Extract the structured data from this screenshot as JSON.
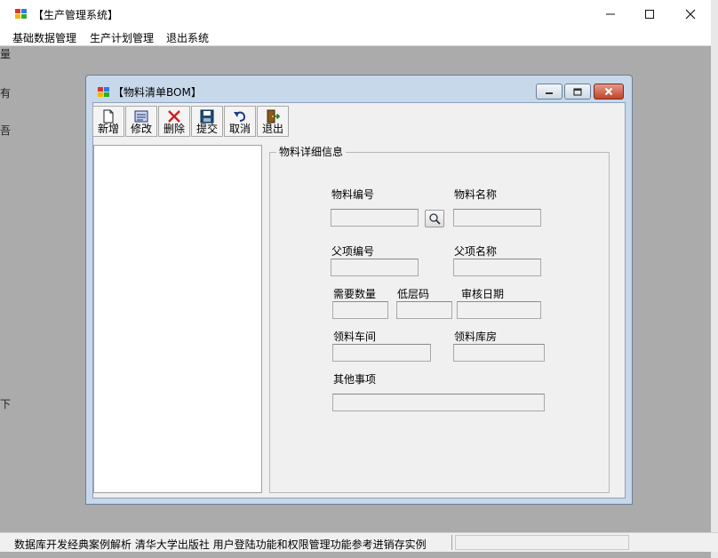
{
  "app": {
    "title": "【生产管理系统】"
  },
  "menu": [
    {
      "label": "基础数据管理"
    },
    {
      "label": "生产计划管理"
    },
    {
      "label": "退出系统"
    }
  ],
  "edge_glyphs": [
    "量",
    "有",
    "吾",
    "下"
  ],
  "child": {
    "title": "【物料清单BOM】"
  },
  "toolbar": [
    {
      "label": "新增",
      "icon": "new-document-icon"
    },
    {
      "label": "修改",
      "icon": "edit-icon"
    },
    {
      "label": "删除",
      "icon": "delete-icon"
    },
    {
      "label": "提交",
      "icon": "save-icon"
    },
    {
      "label": "取消",
      "icon": "undo-icon"
    },
    {
      "label": "退出",
      "icon": "exit-door-icon"
    }
  ],
  "group": {
    "title": "物料详细信息"
  },
  "fields": {
    "material_code": {
      "label": "物料编号",
      "value": ""
    },
    "material_name": {
      "label": "物料名称",
      "value": ""
    },
    "parent_code": {
      "label": "父项编号",
      "value": ""
    },
    "parent_name": {
      "label": "父项名称",
      "value": ""
    },
    "quantity": {
      "label": "需要数量",
      "value": ""
    },
    "low_level_code": {
      "label": "低层码",
      "value": ""
    },
    "review_date": {
      "label": "审核日期",
      "value": ""
    },
    "workshop": {
      "label": "领料车间",
      "value": ""
    },
    "warehouse": {
      "label": "领料库房",
      "value": ""
    },
    "other": {
      "label": "其他事项",
      "value": ""
    }
  },
  "statusbar": {
    "text": "数据库开发经典案例解析  清华大学出版社  用户登陆功能和权限管理功能参考进销存实例"
  },
  "colors": {
    "client_bg": "#f0f0f0",
    "workspace_bg": "#ababab",
    "child_frame": "#c7d8ea",
    "close_red": "#c1442c"
  }
}
